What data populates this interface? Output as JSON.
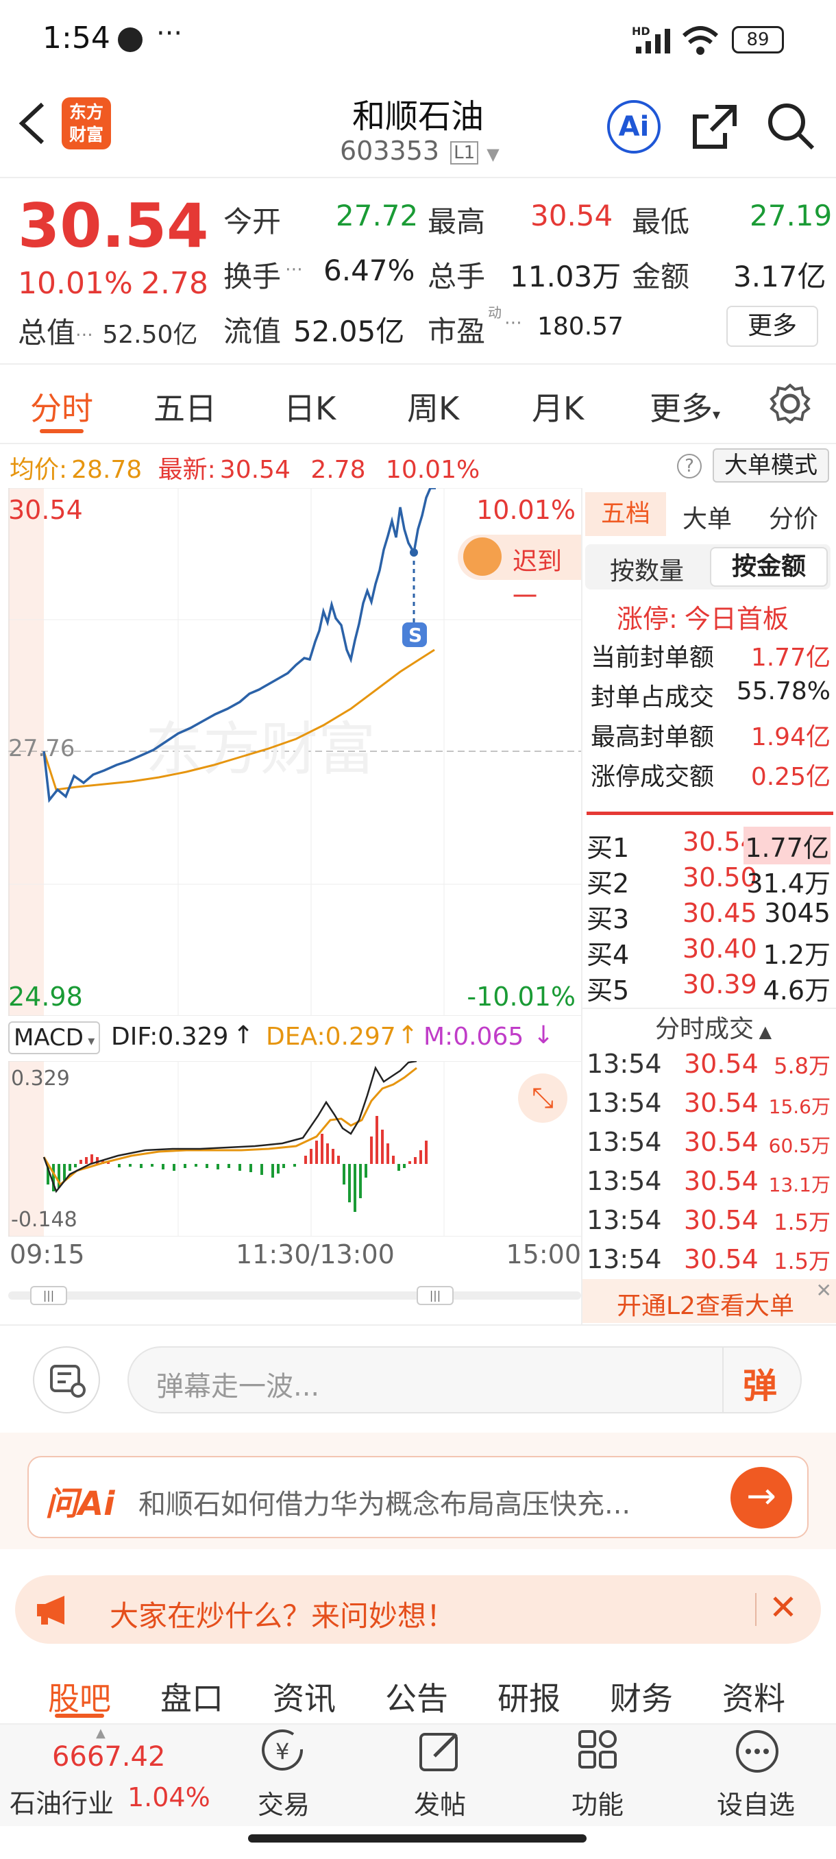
{
  "status_bar": {
    "time": "1:54",
    "battery": "89",
    "network": "HD"
  },
  "header": {
    "title": "和顺石油",
    "code": "603353",
    "level": "L1",
    "logo_line1": "东方",
    "logo_line2": "财富",
    "ai_label": "Ai"
  },
  "quote": {
    "price": "30.54",
    "change_pct": "10.01%",
    "change": "2.78",
    "total_value_label": "总值",
    "total_value": "52.50亿",
    "open_label": "今开",
    "open": "27.72",
    "high_label": "最高",
    "high": "30.54",
    "low_label": "最低",
    "low": "27.19",
    "turnover_label": "换手",
    "turnover": "6.47%",
    "volume_label": "总手",
    "volume": "11.03万",
    "amount_label": "金额",
    "amount": "3.17亿",
    "float_value_label": "流值",
    "float_value": "52.05亿",
    "pe_label": "市盈",
    "pe_sup": "动",
    "pe": "180.57",
    "more_label": "更多"
  },
  "chart_tabs": [
    "分时",
    "五日",
    "日K",
    "周K",
    "月K",
    "更多"
  ],
  "info_line": {
    "avg_label": "均价:",
    "avg": "28.78",
    "latest_label": "最新:",
    "latest": "30.54",
    "change": "2.78",
    "change_pct": "10.01%",
    "big_mode": "大单模式"
  },
  "chart_labels": {
    "top_price": "30.54",
    "top_pct": "10.01%",
    "mid_price": "27.76",
    "bottom_price": "24.98",
    "bottom_pct": "-10.01%",
    "late_promo": "迟到一",
    "watermark": "东方财富"
  },
  "macd": {
    "name": "MACD",
    "dif": "DIF:0.329",
    "dea": "DEA:0.297",
    "m": "M:0.065",
    "top": "0.329",
    "bottom": "-0.148"
  },
  "time_axis": {
    "start": "09:15",
    "mid": "11:30/13:00",
    "end": "15:00"
  },
  "side_panel": {
    "tabs": [
      "五档",
      "大单",
      "分价"
    ],
    "toggle": [
      "按数量",
      "按金额"
    ],
    "limit_status_label": "涨停:",
    "limit_status": "今日首板",
    "stats": [
      {
        "label": "当前封单额",
        "value": "1.77亿"
      },
      {
        "label": "封单占成交",
        "value": "55.78%"
      },
      {
        "label": "最高封单额",
        "value": "1.94亿"
      },
      {
        "label": "涨停成交额",
        "value": "0.25亿"
      }
    ],
    "bids": [
      {
        "label": "买1",
        "price": "30.54",
        "vol": "1.77亿"
      },
      {
        "label": "买2",
        "price": "30.50",
        "vol": "31.4万"
      },
      {
        "label": "买3",
        "price": "30.45",
        "vol": "3045"
      },
      {
        "label": "买4",
        "price": "30.40",
        "vol": "1.2万"
      },
      {
        "label": "买5",
        "price": "30.39",
        "vol": "4.6万"
      }
    ],
    "trades_title": "分时成交",
    "trades": [
      {
        "time": "13:54",
        "price": "30.54",
        "vol": "5.8万"
      },
      {
        "time": "13:54",
        "price": "30.54",
        "vol": "15.6万"
      },
      {
        "time": "13:54",
        "price": "30.54",
        "vol": "60.5万"
      },
      {
        "time": "13:54",
        "price": "30.54",
        "vol": "13.1万"
      },
      {
        "time": "13:54",
        "price": "30.54",
        "vol": "1.5万"
      },
      {
        "time": "13:54",
        "price": "30.54",
        "vol": "1.5万"
      }
    ],
    "l2_promo": "开通L2查看大单"
  },
  "danmu": {
    "placeholder": "弹幕走一波...",
    "send": "弹"
  },
  "ask_ai": {
    "brand": "问Ai",
    "question": "和顺石如何借力华为概念布局高压快充..."
  },
  "banner": {
    "text": "大家在炒什么？来问妙想！"
  },
  "bottom_tabs": [
    "股吧",
    "盘口",
    "资讯",
    "公告",
    "研报",
    "财务",
    "资料"
  ],
  "bottom_nav": {
    "index_value": "6667.42",
    "index_name": "石油行业",
    "index_pct": "1.04%",
    "items": [
      "交易",
      "发帖",
      "功能",
      "设自选"
    ]
  },
  "colors": {
    "up": "#e53935",
    "down": "#1a9b35",
    "avg": "#e6950f",
    "price_line": "#2b62a8",
    "accent": "#f05a22"
  }
}
